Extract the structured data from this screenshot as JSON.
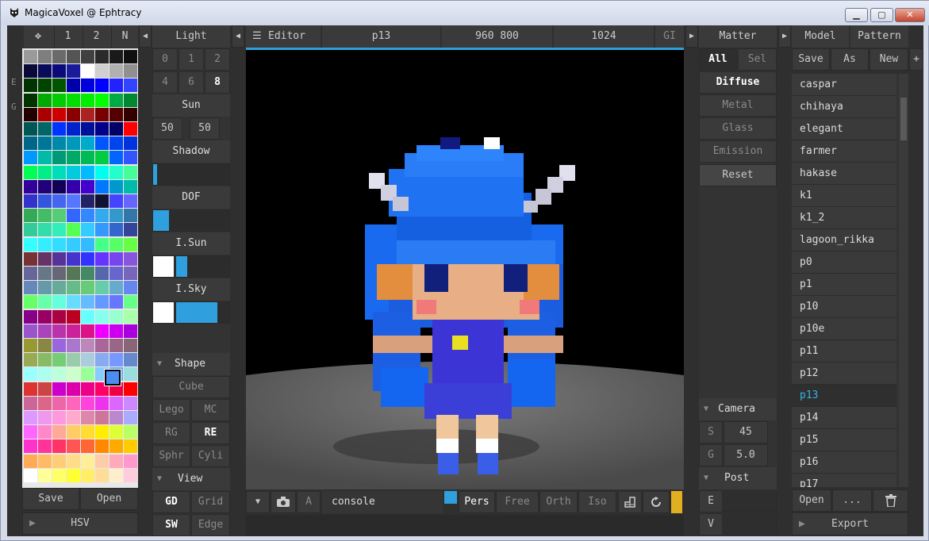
{
  "window": {
    "title": "MagicaVoxel @ Ephtracy",
    "min": "▁",
    "max": "▢",
    "close": "✕"
  },
  "palette": {
    "tabs": [
      "1",
      "2",
      "N"
    ],
    "side": [
      "E",
      "G"
    ],
    "save": "Save",
    "open": "Open",
    "hsv": "HSV",
    "colors": [
      "#9a9a9a",
      "#7e7e7e",
      "#6a6a6a",
      "#555555",
      "#404040",
      "#2a2a2a",
      "#1a1a1a",
      "#101010",
      "#0a0a3a",
      "#0a0a5a",
      "#0a0a7a",
      "#1a1a9a",
      "#ffffff",
      "#d0d0d0",
      "#b0b0b0",
      "#909090",
      "#003300",
      "#004400",
      "#005500",
      "#0000aa",
      "#0000dd",
      "#0000ff",
      "#2222ff",
      "#3344ff",
      "#003300",
      "#00aa00",
      "#00cc00",
      "#00dd00",
      "#00ee00",
      "#00ff00",
      "#00aa44",
      "#008833",
      "#220000",
      "#aa0000",
      "#cc0000",
      "#880000",
      "#aa2222",
      "#770000",
      "#550000",
      "#330000",
      "#005555",
      "#006666",
      "#0033ff",
      "#0022cc",
      "#001199",
      "#000088",
      "#000066",
      "#ff0000",
      "#006688",
      "#007799",
      "#0088aa",
      "#0099bb",
      "#00aacc",
      "#0055ff",
      "#0044ee",
      "#0033dd",
      "#0099ff",
      "#00bbaa",
      "#009977",
      "#00aa66",
      "#00bb55",
      "#00cc44",
      "#0066ff",
      "#3355ff",
      "#00ff55",
      "#00ee88",
      "#00ddbb",
      "#00ccdd",
      "#00bbff",
      "#00ffee",
      "#22ffcc",
      "#44ff99",
      "#330099",
      "#220077",
      "#110055",
      "#3300aa",
      "#4400cc",
      "#0077ff",
      "#0099cc",
      "#00bbaa",
      "#3333cc",
      "#3355dd",
      "#4466ee",
      "#5577ff",
      "#222266",
      "#111133",
      "#4444ff",
      "#6666ff",
      "#33aa55",
      "#44bb66",
      "#55cc77",
      "#3366ff",
      "#3388ff",
      "#33aaee",
      "#3399cc",
      "#3377aa",
      "#33cc99",
      "#33ddaa",
      "#33eebb",
      "#55ff55",
      "#33ccff",
      "#3399ff",
      "#3366cc",
      "#334499",
      "#33ffff",
      "#33eeff",
      "#33ddff",
      "#33ccff",
      "#33bbff",
      "#44ff88",
      "#55ff66",
      "#66ff44",
      "#773333",
      "#663366",
      "#553399",
      "#4433cc",
      "#3333ff",
      "#6633ff",
      "#7744ee",
      "#8855dd",
      "#666699",
      "#667788",
      "#666677",
      "#557755",
      "#448866",
      "#5566aa",
      "#6666cc",
      "#7766bb",
      "#6688bb",
      "#6699aa",
      "#66aa99",
      "#66bb88",
      "#66cc77",
      "#66ccaa",
      "#66aacc",
      "#6688ee",
      "#66ff66",
      "#66ffaa",
      "#66ffdd",
      "#66ddff",
      "#66bbff",
      "#6699ff",
      "#6677ff",
      "#66ff88",
      "#880088",
      "#990066",
      "#aa0044",
      "#bb0022",
      "#66ffff",
      "#88ffee",
      "#99ffcc",
      "#aaffaa",
      "#9955cc",
      "#aa44bb",
      "#bb33aa",
      "#cc2299",
      "#dd1188",
      "#ee00ff",
      "#cc00ee",
      "#aa00dd",
      "#999933",
      "#888844",
      "#9966dd",
      "#aa77cc",
      "#bb88bb",
      "#aa6699",
      "#996688",
      "#886677",
      "#99aa55",
      "#88bb66",
      "#77cc77",
      "#99ccaa",
      "#aaccdd",
      "#88aaee",
      "#7799ff",
      "#6688cc",
      "#99ffff",
      "#aaffee",
      "#bbffdd",
      "#ccffcc",
      "#99ff99",
      "#88ccff",
      "#66aaee",
      "#99dddd",
      "#dd3333",
      "#cc4444",
      "#cc00cc",
      "#dd00aa",
      "#ee0088",
      "#ff0066",
      "#ee0044",
      "#ff0000",
      "#cc6699",
      "#dd6688",
      "#ee66aa",
      "#ff66bb",
      "#ff44dd",
      "#ee33ee",
      "#dd66ff",
      "#cc88ff",
      "#dd99ff",
      "#ee99ee",
      "#ff99dd",
      "#ffaacc",
      "#dd88aa",
      "#cc7799",
      "#bb88cc",
      "#aaaaff",
      "#ff66ff",
      "#ff88cc",
      "#ffaa99",
      "#ffcc66",
      "#ffdd33",
      "#ffee00",
      "#ddff33",
      "#bbff66",
      "#ff33cc",
      "#ff3399",
      "#ff3366",
      "#ff5555",
      "#ff6633",
      "#ff8800",
      "#ffaa00",
      "#ffcc00",
      "#ffaa55",
      "#ffbb66",
      "#ffcc77",
      "#ffdd88",
      "#ffee99",
      "#ffccaa",
      "#ffaabb",
      "#ff99cc",
      "#ffffff",
      "#ffff99",
      "#ffff66",
      "#ffff33",
      "#ffee66",
      "#ffdd99",
      "#ffeecc",
      "#ffccdd"
    ]
  },
  "light": {
    "title": "Light",
    "nums_row1": [
      "0",
      "1",
      "2"
    ],
    "nums_row2": [
      "4",
      "6",
      "8"
    ],
    "sun": "Sun",
    "sun_a": "50",
    "sun_b": "50",
    "shadow": "Shadow",
    "dof": "DOF",
    "isun": "I.Sun",
    "isky": "I.Sky",
    "shape": "Shape",
    "cube": "Cube",
    "lego": "Lego",
    "mc": "MC",
    "rg": "RG",
    "re": "RE",
    "sphr": "Sphr",
    "cyli": "Cyli",
    "view": "View",
    "gd": "GD",
    "grid": "Grid",
    "sw": "SW",
    "edge": "Edge",
    "shadow_level": 0.05,
    "dof_level": 0.2,
    "isun_level": 0.2,
    "isky_level": 0.75
  },
  "editor": {
    "menu": "Editor",
    "file": "p13",
    "size": "960 800",
    "samples": "1024",
    "gi": "GI",
    "console": "console",
    "a": "A",
    "modes": [
      "Pers",
      "Free",
      "Orth",
      "Iso"
    ]
  },
  "matter": {
    "title": "Matter",
    "all": "All",
    "sel": "Sel",
    "types": [
      "Diffuse",
      "Metal",
      "Glass",
      "Emission"
    ],
    "reset": "Reset",
    "camera": "Camera",
    "s_label": "S",
    "s_val": "45",
    "g_label": "G",
    "g_val": "5.0",
    "post": "Post",
    "e_label": "E",
    "v_label": "V"
  },
  "model": {
    "tabs": [
      "Model",
      "Pattern"
    ],
    "save": "Save",
    "as": "As",
    "new": "New",
    "plus": "+",
    "items": [
      "caspar",
      "chihaya",
      "elegant",
      "farmer",
      "hakase",
      "k1",
      "k1_2",
      "lagoon_rikka",
      "p0",
      "p1",
      "p10",
      "p10e",
      "p11",
      "p12",
      "p13",
      "p14",
      "p15",
      "p16",
      "p17"
    ],
    "selected": "p13",
    "open": "Open",
    "more": "...",
    "export": "Export"
  }
}
